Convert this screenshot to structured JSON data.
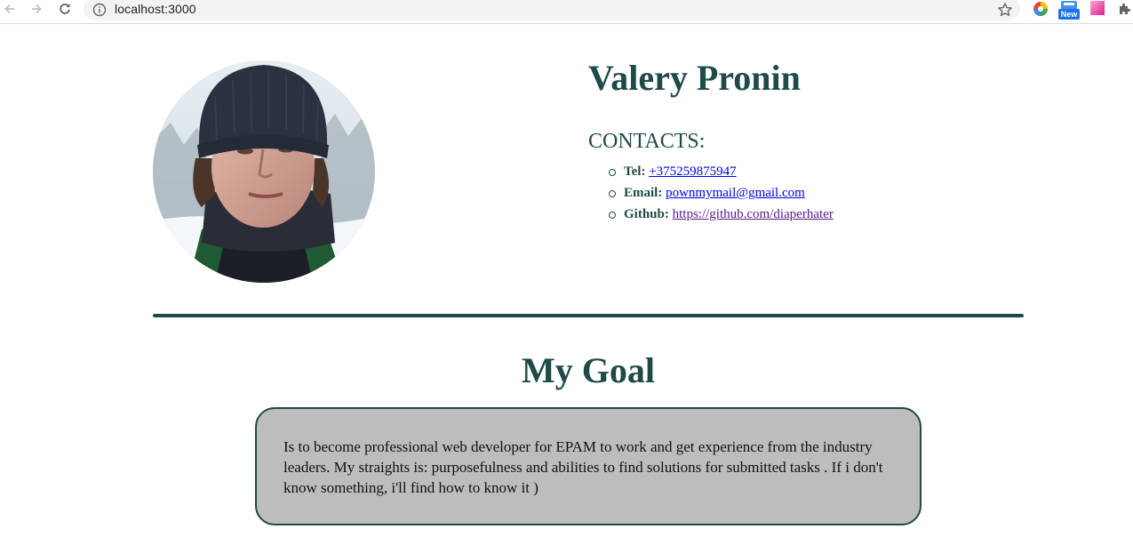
{
  "browser": {
    "url": "localhost:3000",
    "badge_new": "New"
  },
  "profile": {
    "name": "Valery Pronin",
    "contacts_title": "CONTACTS:",
    "contacts": [
      {
        "label": "Tel:",
        "value": "+375259875947"
      },
      {
        "label": "Email:",
        "value": "pownmymail@gmail.com"
      },
      {
        "label": "Github:",
        "value": "https://github.com/diaperhater"
      }
    ]
  },
  "goal": {
    "title": "My Goal",
    "text": "Is to become professional web developer for EPAM to work and get experience from the industry leaders. My straights is: purposefulness and abilities to find solutions for submitted tasks . If i don't know something, i'll find how to know it )"
  },
  "colors": {
    "accent": "#1e4a48",
    "goal_box_bg": "#bdbdbd",
    "link": "#0000ee",
    "link_visited": "#551a8b"
  }
}
